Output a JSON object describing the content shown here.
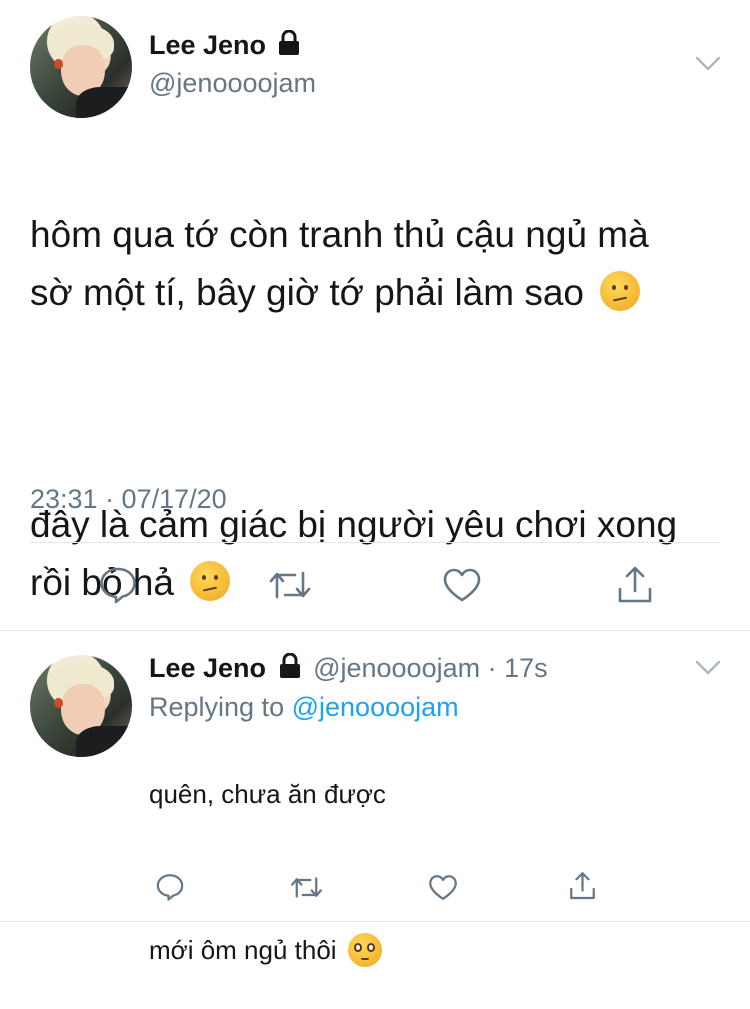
{
  "main_tweet": {
    "display_name": "Lee Jeno",
    "handle": "@jenoooojam",
    "avatar_icon": "profile-photo",
    "lock_icon": "lock-icon",
    "text_p1": "hôm qua tớ còn tranh thủ cậu ngủ mà\nsờ một tí, bây giờ tớ phải làm sao",
    "text_p2": "đây là cảm giác bị người yêu chơi xong\nrồi bỏ hả",
    "timestamp": "23:31 · 07/17/20"
  },
  "reply_tweet": {
    "display_name": "Lee Jeno",
    "handle": "@jenoooojam",
    "separator": "·",
    "age": "17s",
    "replying_prefix": "Replying to",
    "replying_handle": "@jenoooojam",
    "text_p1": "quên, chưa ăn được",
    "text_p2": "mới ôm ngủ thôi"
  },
  "actions": [
    "reply-icon",
    "retweet-icon",
    "like-icon",
    "share-icon"
  ],
  "colors": {
    "text": "#14171a",
    "muted": "#657786",
    "link": "#1da1f2",
    "divider": "#e1e8ed",
    "icon": "#657786"
  }
}
